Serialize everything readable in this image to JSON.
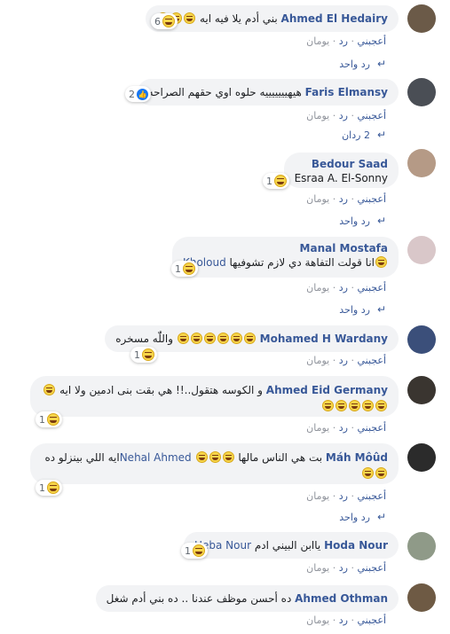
{
  "comments": [
    {
      "author": "Ahmed El Hedairy",
      "text": "بني أدم يلا فيه ايه",
      "emoji_after": 2,
      "reaction_count": "6",
      "reaction_type": "haha",
      "actions": [
        "أعجبني",
        "رد",
        "يومان"
      ],
      "replies_label": "رد واحد"
    },
    {
      "author": "Faris Elmansy",
      "text": "هيهيييييييه حلوه اوي حقهم الصراحه",
      "reaction_count": "2",
      "reaction_type": "like",
      "actions": [
        "أعجبني",
        "رد",
        "يومان"
      ],
      "replies_label": "2 ردان"
    },
    {
      "author": "Bedour Saad",
      "mention": "Esraa A. El-Sonny",
      "reaction_count": "1",
      "reaction_type": "haha",
      "actions": [
        "أعجبني",
        "رد",
        "يومان"
      ],
      "replies_label": "رد واحد"
    },
    {
      "author": "Manal Mostafa",
      "text": "انا قولت التفاهة دي لازم تشوفيها",
      "mention": "Kholoud",
      "reaction_count": "1",
      "reaction_type": "haha",
      "actions": [
        "أعجبني",
        "رد",
        "يومان"
      ],
      "replies_label": "رد واحد"
    },
    {
      "author": "Mohamed H Wardany",
      "text": "واللّٰه مسخره",
      "reaction_count": "1",
      "reaction_type": "haha",
      "actions": [
        "أعجبني",
        "رد",
        "يومان"
      ]
    },
    {
      "author": "Ahmed Eid Germany",
      "text": "و الكوسه هتقول..!! هي بقت بنى ادمين ولا ايه",
      "reaction_count": "1",
      "reaction_type": "haha",
      "actions": [
        "أعجبني",
        "رد",
        "يومان"
      ]
    },
    {
      "author": "Máh Môûd",
      "text": "بت هي الناس مالها",
      "mention": "Nehal Ahmed",
      "text2": "ايه اللي بينزلو ده",
      "reaction_count": "1",
      "reaction_type": "haha",
      "actions": [
        "أعجبني",
        "رد",
        "يومان"
      ],
      "replies_label": "رد واحد"
    },
    {
      "author": "Hoda Nour",
      "text": "ياابن البيني ادم",
      "mention": "Heba Nour",
      "reaction_count": "1",
      "reaction_type": "haha",
      "actions": [
        "أعجبني",
        "رد",
        "يومان"
      ]
    },
    {
      "author": "Ahmed Othman",
      "text": "ده أحسن موظف عندنا .. ده بني أدم شغل",
      "actions": [
        "أعجبني",
        "رد",
        "يومان"
      ]
    }
  ],
  "avatar_colors": [
    "#6b5a48",
    "#4a4e55",
    "#b59a86",
    "#d9c7c9",
    "#3b4f7a",
    "#3a3530",
    "#2b2b2b",
    "#8f9a88",
    "#6e5a44"
  ]
}
